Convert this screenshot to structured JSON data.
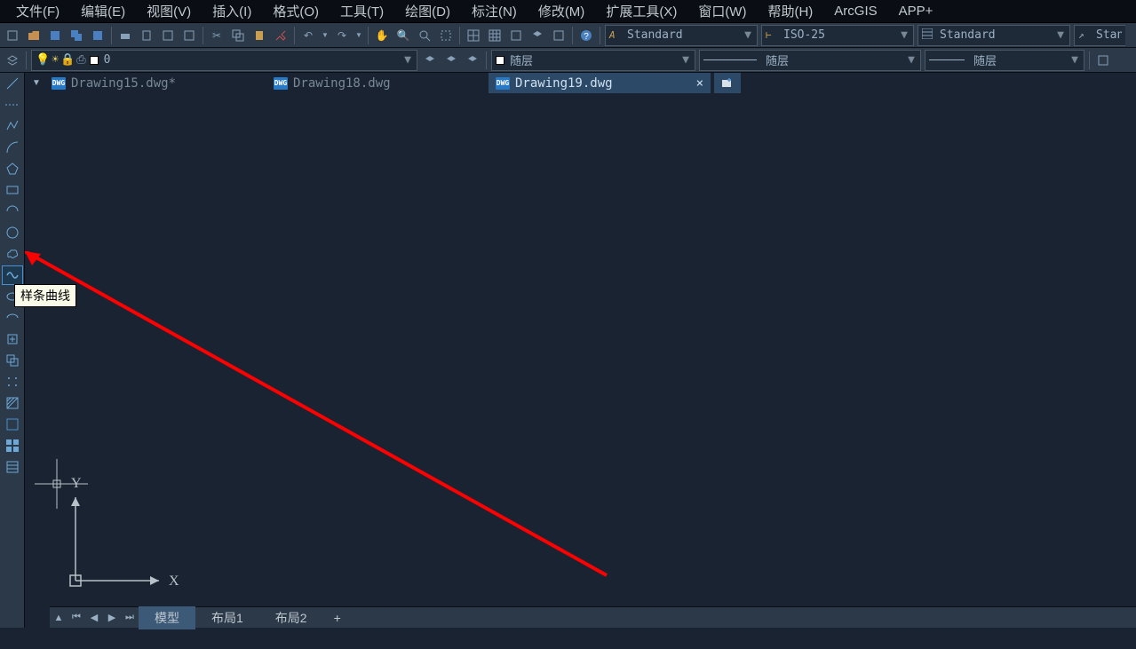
{
  "menu": {
    "items": [
      {
        "label": "文件(F)"
      },
      {
        "label": "编辑(E)"
      },
      {
        "label": "视图(V)"
      },
      {
        "label": "插入(I)"
      },
      {
        "label": "格式(O)"
      },
      {
        "label": "工具(T)"
      },
      {
        "label": "绘图(D)"
      },
      {
        "label": "标注(N)"
      },
      {
        "label": "修改(M)"
      },
      {
        "label": "扩展工具(X)"
      },
      {
        "label": "窗口(W)"
      },
      {
        "label": "帮助(H)"
      },
      {
        "label": "ArcGIS"
      },
      {
        "label": "APP+"
      }
    ]
  },
  "toolbar1": {
    "text_style": "Standard",
    "dim_style": "ISO-25",
    "table_style": "Standard",
    "other_style": "Stan"
  },
  "toolbar2": {
    "layer_name": "0",
    "color_label": "随层",
    "linetype_label": "随层",
    "lineweight_label": "随层"
  },
  "tabs": [
    {
      "name": "Drawing15.dwg*",
      "active": false
    },
    {
      "name": "Drawing18.dwg",
      "active": false
    },
    {
      "name": "Drawing19.dwg",
      "active": true
    }
  ],
  "tooltip": "样条曲线",
  "ucs": {
    "x": "X",
    "y": "Y"
  },
  "layout_tabs": {
    "items": [
      {
        "label": "模型",
        "active": true
      },
      {
        "label": "布局1",
        "active": false
      },
      {
        "label": "布局2",
        "active": false
      }
    ]
  },
  "colors": {
    "accent": "#4a90d0",
    "red": "#ff0000"
  }
}
